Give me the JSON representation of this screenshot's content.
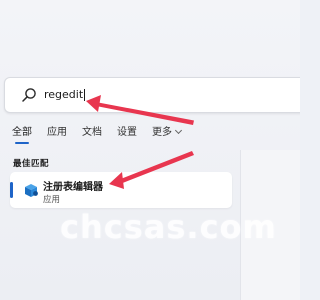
{
  "search": {
    "value": "regedit"
  },
  "tabs": [
    {
      "label": "全部",
      "active": true
    },
    {
      "label": "应用"
    },
    {
      "label": "文档"
    },
    {
      "label": "设置"
    },
    {
      "label": "更多"
    }
  ],
  "best_match": {
    "section_title": "最佳匹配",
    "result": {
      "title": "注册表编辑器",
      "subtitle": "应用"
    }
  },
  "watermark": "chcsas.com",
  "colors": {
    "accent": "#1e64c8",
    "annotation_arrow": "#e8364f"
  },
  "icons": [
    "search-icon",
    "chevron-down-icon",
    "registry-editor-icon"
  ]
}
